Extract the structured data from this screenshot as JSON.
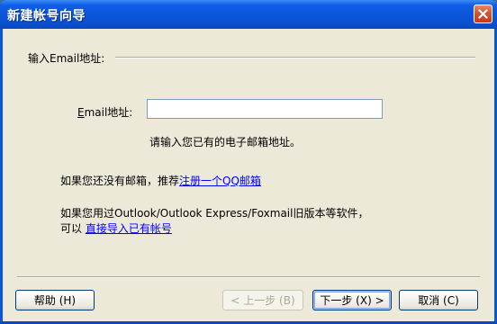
{
  "window": {
    "title": "新建帐号向导"
  },
  "form": {
    "group_legend": "输入Email地址:",
    "email_label_prefix": "E",
    "email_label_rest": "mail地址:",
    "email_value": "",
    "hint": "请输入您已有的电子邮箱地址。",
    "no_email_text": "如果您还没有邮箱，推荐",
    "register_link": "注册一个QQ邮箱",
    "import_text_line1": "如果您用过Outlook/Outlook Express/Foxmail旧版本等软件，",
    "import_text_line2_prefix": "可以",
    "import_link": "直接导入已有帐号"
  },
  "buttons": {
    "help": "帮助 (H)",
    "prev": "< 上一步 (B)",
    "next": "下一步 (X) >",
    "cancel": "取消 (C)"
  },
  "icons": {
    "close": "close-icon"
  },
  "colors": {
    "titlebar": "#0a55d8",
    "dialog_bg": "#ece9d8",
    "link": "#0000ff",
    "close_button": "#d6532f"
  }
}
